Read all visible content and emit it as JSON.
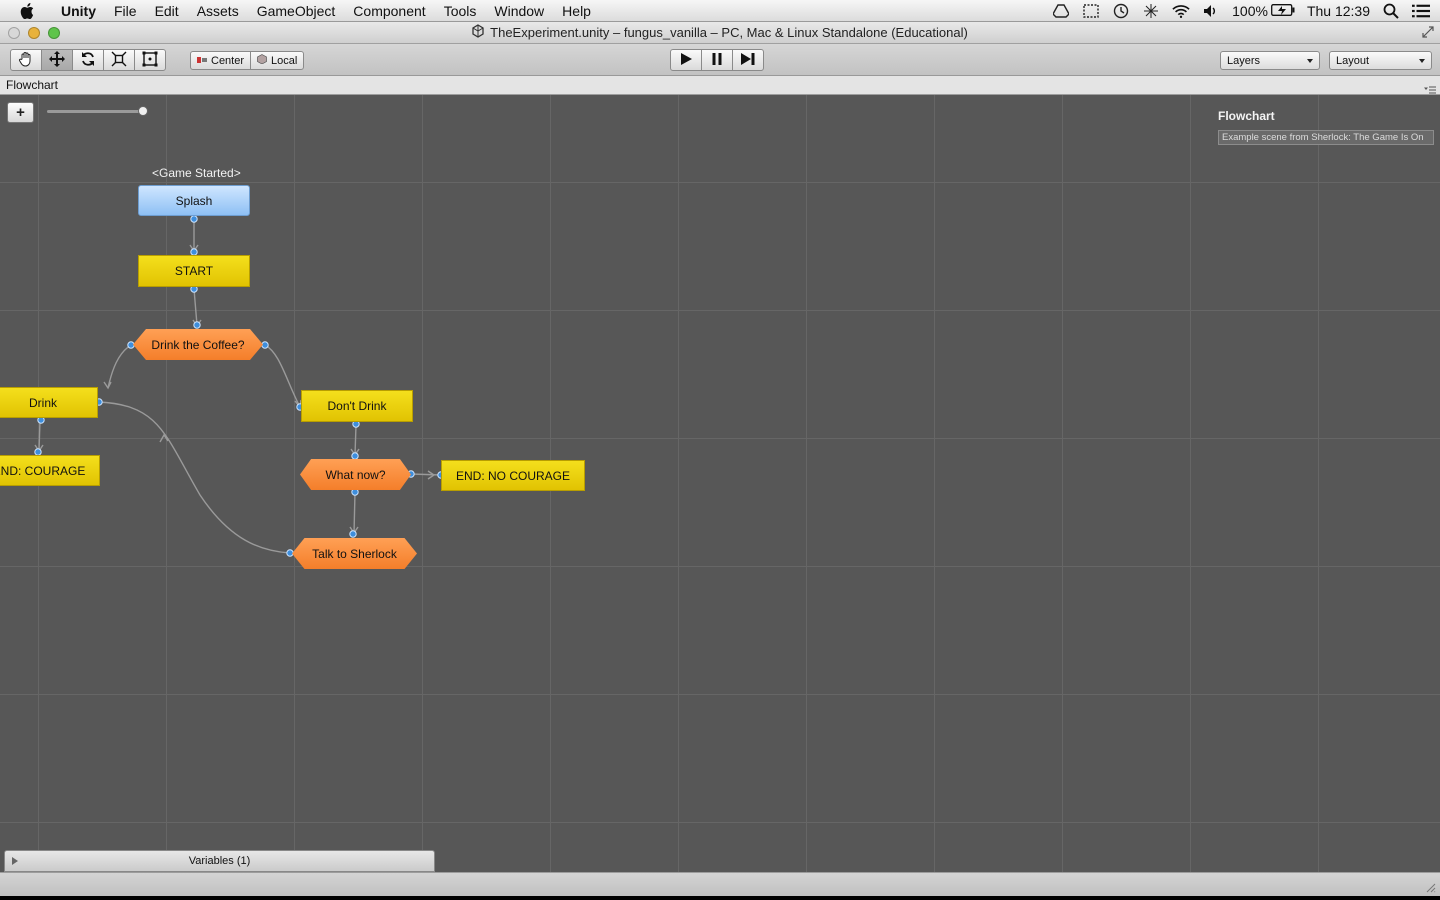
{
  "menubar": {
    "app_name": "Unity",
    "items": [
      "File",
      "Edit",
      "Assets",
      "GameObject",
      "Component",
      "Tools",
      "Window",
      "Help"
    ],
    "battery": "100%",
    "clock": "Thu 12:39"
  },
  "window": {
    "title": "TheExperiment.unity – fungus_vanilla – PC, Mac & Linux Standalone (Educational)"
  },
  "toolbar": {
    "pivot_center": "Center",
    "pivot_local": "Local",
    "layers_label": "Layers",
    "layout_label": "Layout"
  },
  "tab": {
    "label": "Flowchart"
  },
  "flowchart": {
    "event_label": "<Game Started>",
    "blocks": {
      "splash": "Splash",
      "start": "START",
      "drink_coffee": "Drink the Coffee?",
      "drink": "Drink",
      "dont_drink": "Don't Drink",
      "end_courage": "END: COURAGE",
      "what_now": "What now?",
      "end_no_courage": "END: NO COURAGE",
      "talk_sherlock": "Talk to Sherlock"
    },
    "colors": {
      "canvas": "#575757",
      "grid": "#666666",
      "block_yellow": "#EBD111",
      "block_blue": "#A8D0FA",
      "block_orange": "#F8893C",
      "connector": "#3E8EDC"
    },
    "zoom_level": 1.0
  },
  "inspector": {
    "title": "Flowchart",
    "description": "Example scene from Sherlock: The Game Is On"
  },
  "variables": {
    "label": "Variables (1)"
  }
}
